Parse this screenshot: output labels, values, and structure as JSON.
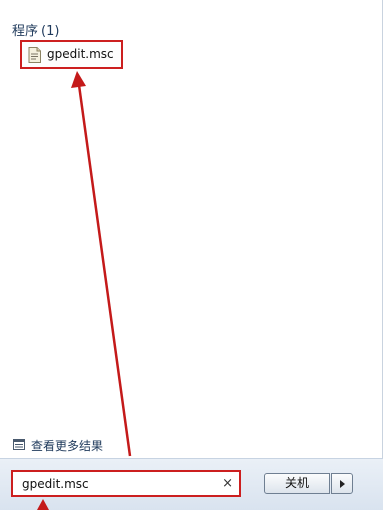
{
  "results": {
    "section_title": "程序",
    "section_count": "(1)",
    "items": [
      {
        "label": "gpedit.msc",
        "icon": "msc-file-icon"
      }
    ]
  },
  "see_more": {
    "label": "查看更多结果",
    "icon": "more-results-icon"
  },
  "search": {
    "value": "gpedit.msc",
    "clear_glyph": "×"
  },
  "shutdown": {
    "label": "关机",
    "arrow_icon": "chevron-right-icon"
  },
  "annotation": {
    "highlight_color": "#cc1f1f",
    "arrow_color": "#c41a1a"
  }
}
